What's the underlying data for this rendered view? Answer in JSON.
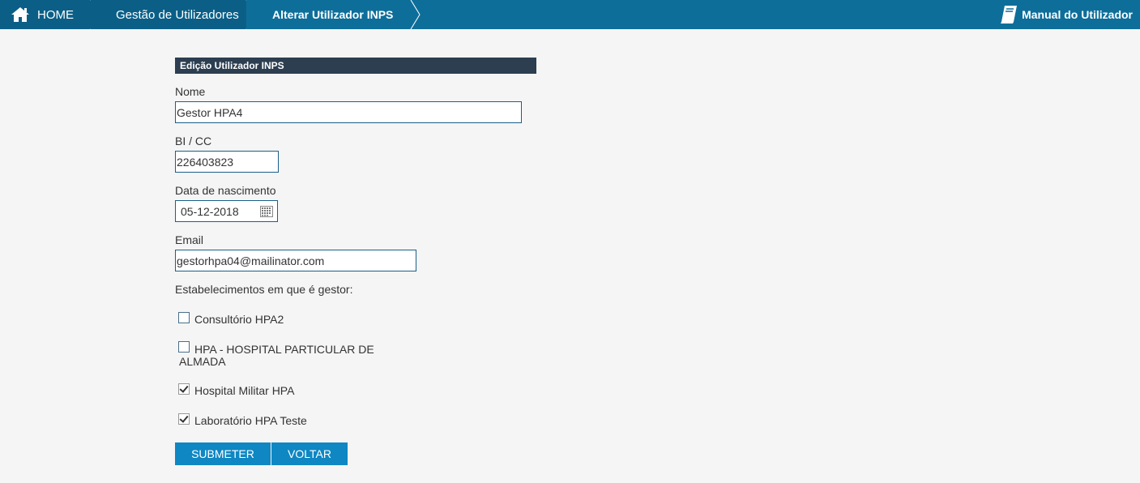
{
  "breadcrumb": {
    "home": "HOME",
    "gestao": "Gestão de Utilizadores",
    "current": "Alterar Utilizador INPS"
  },
  "manual_label": "Manual do Utilizador",
  "form": {
    "section_title": "Edição Utilizador INPS",
    "nome_label": "Nome",
    "nome_value": "Gestor HPA4",
    "bi_label": "BI / CC",
    "bi_value": "226403823",
    "data_label": "Data de nascimento",
    "data_value": "05-12-2018",
    "email_label": "Email",
    "email_value": "gestorhpa04@mailinator.com",
    "estab_label": "Estabelecimentos em que é gestor:",
    "estabelecimentos": [
      {
        "label": "Consultório HPA2",
        "checked": false
      },
      {
        "label_line1": "HPA - HOSPITAL PARTICULAR DE",
        "label_line2": "ALMADA",
        "checked": false
      },
      {
        "label": "Hospital Militar HPA",
        "checked": true
      },
      {
        "label": "Laboratório HPA Teste",
        "checked": true
      }
    ]
  },
  "buttons": {
    "submit": "SUBMETER",
    "back": "VOLTAR"
  },
  "colors": {
    "topbar": "#0e6e9a",
    "topbar_dark": "#0b5f87",
    "section_header": "#2c3e50",
    "button": "#0e87c3"
  }
}
